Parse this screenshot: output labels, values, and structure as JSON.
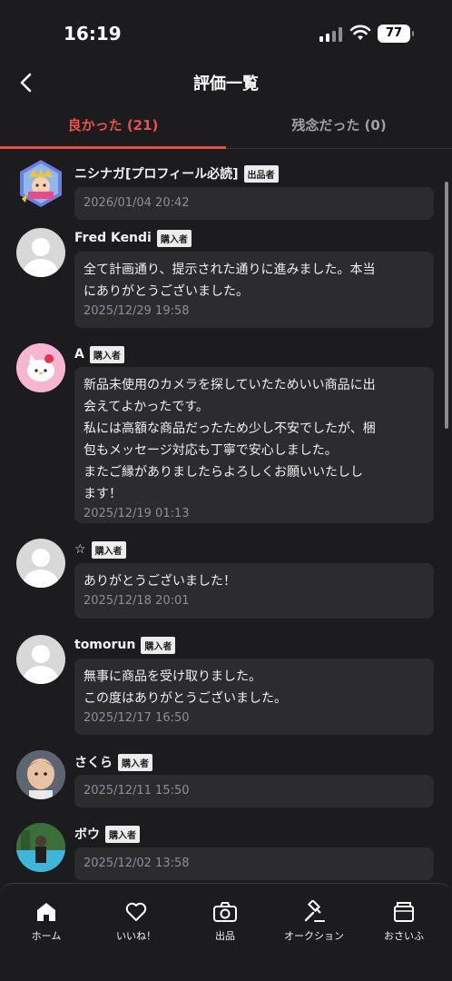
{
  "status_bar": {
    "time": "16:19",
    "battery": "77"
  },
  "header": {
    "title": "評価一覧"
  },
  "tabs": [
    {
      "label": "良かった (21)",
      "active": true
    },
    {
      "label": "残念だった (0)",
      "active": false
    }
  ],
  "reviews": [
    {
      "name": "ニシナガ[プロフィール必読]",
      "role": "出品者",
      "comment": "",
      "date": "2026/01/04 20:42",
      "avatar": "crown-avatar"
    },
    {
      "name": "Fred Kendi",
      "role": "購入者",
      "comment": "全て計画通り、提示された通りに進みました。本当\nにありがとうございました。",
      "date": "2025/12/29 19:58",
      "avatar": "default-avatar"
    },
    {
      "name": "A",
      "role": "購入者",
      "comment": "新品未使用のカメラを探していたためいい商品に出\n会えてよかったです。\n私には高額な商品だったため少し不安でしたが、梱\n包もメッセージ対応も丁寧で安心しました。\nまたご縁がありましたらよろしくお願いいたしし\nます！",
      "date": "2025/12/19 01:13",
      "avatar": "kitty-avatar"
    },
    {
      "name": "☆",
      "role": "購入者",
      "comment": "ありがとうございました！",
      "date": "2025/12/18 20:01",
      "avatar": "default-avatar"
    },
    {
      "name": "tomorun",
      "role": "購入者",
      "comment": "無事に商品を受け取りました。\nこの度はありがとうございました。",
      "date": "2025/12/17 16:50",
      "avatar": "default-avatar"
    },
    {
      "name": "さくら",
      "role": "購入者",
      "comment": "",
      "date": "2025/12/11 15:50",
      "avatar": "child-photo-avatar"
    },
    {
      "name": "ボウ",
      "role": "購入者",
      "comment": "",
      "date": "2025/12/02 13:58",
      "avatar": "pool-photo-avatar"
    }
  ],
  "tabbar": [
    {
      "label": "ホーム",
      "icon": "home-icon"
    },
    {
      "label": "いいね！",
      "icon": "heart-icon"
    },
    {
      "label": "出品",
      "icon": "camera-icon"
    },
    {
      "label": "オークション",
      "icon": "gavel-icon"
    },
    {
      "label": "おさいふ",
      "icon": "wallet-icon"
    }
  ],
  "colors": {
    "accent": "#e8504c",
    "background": "#1c1c1e",
    "bubble": "#2c2c2e"
  }
}
